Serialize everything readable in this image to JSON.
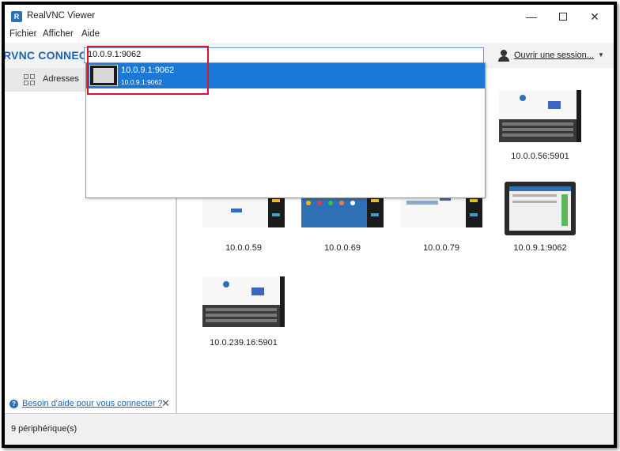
{
  "window": {
    "title": "RealVNC Viewer",
    "app_icon_letter": "R"
  },
  "menu": [
    "Fichier",
    "Afficher",
    "Aide"
  ],
  "toolbar": {
    "brand": "RVNC CONNECT",
    "search_value": "10.0.9.1:9062",
    "session_label": "Ouvrir une session..."
  },
  "sidebar": {
    "items": [
      {
        "label": "Adresses",
        "icon": "grid-icon"
      }
    ],
    "help_link": "Besoin d'aide pour vous connecter ?"
  },
  "dropdown": {
    "items": [
      {
        "title": "10.0.9.1:9062",
        "subtitle": "10.0.9.1:9062",
        "selected": true
      }
    ]
  },
  "devices": [
    {
      "label": "10.0.0.56:5901",
      "thumb": "keyboard-card"
    },
    {
      "label": "10.0.0.59",
      "thumb": "login-white"
    },
    {
      "label": "10.0.0.69",
      "thumb": "launcher-blue"
    },
    {
      "label": "10.0.0.79",
      "thumb": "list-white"
    },
    {
      "label": "10.0.9.1:9062",
      "thumb": "tablet-app"
    },
    {
      "label": "10.0.239.16:5901",
      "thumb": "keyboard-card"
    }
  ],
  "status": {
    "text": "9 périphérique(s)"
  },
  "colors": {
    "accent": "#1a79d6",
    "brand": "#1d64b3",
    "highlight": "#e0141e"
  }
}
